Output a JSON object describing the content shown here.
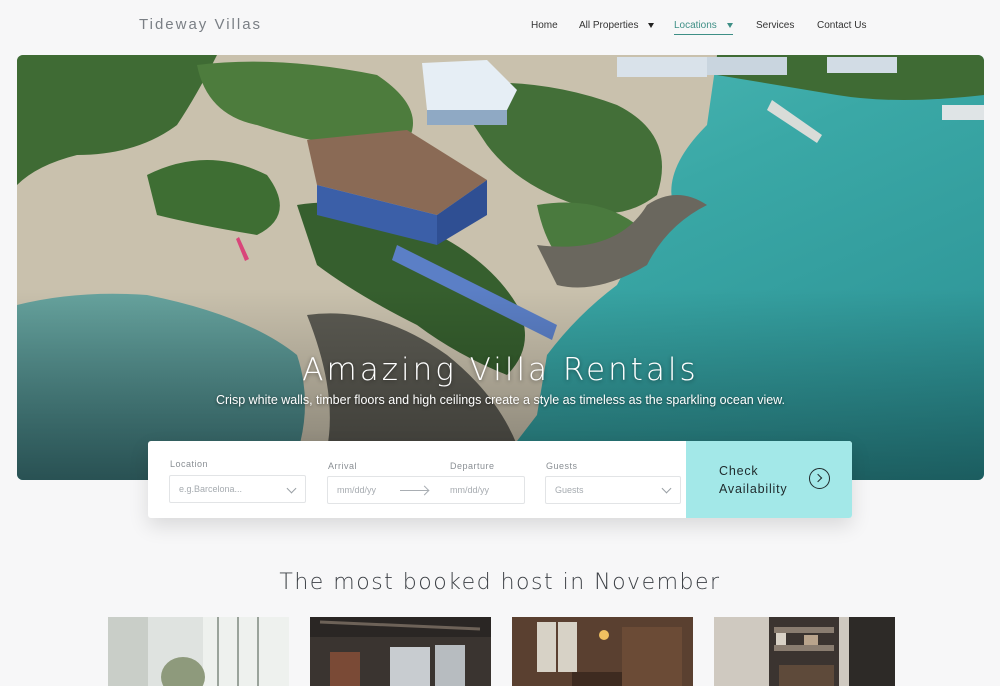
{
  "header": {
    "brand": "Tideway Villas",
    "nav": [
      {
        "label": "Home",
        "dropdown": false,
        "active": false
      },
      {
        "label": "All Properties",
        "dropdown": true,
        "active": false
      },
      {
        "label": "Locations",
        "dropdown": true,
        "active": true
      },
      {
        "label": "Services",
        "dropdown": false,
        "active": false
      },
      {
        "label": "Contact Us",
        "dropdown": false,
        "active": false
      }
    ]
  },
  "hero": {
    "title": "Amazing Villa Rentals",
    "subtitle": "Crisp white walls, timber floors and high ceilings create a style as timeless as the sparkling ocean view."
  },
  "booking": {
    "location": {
      "label": "Location",
      "placeholder": "e.g.Barcelona..."
    },
    "arrival": {
      "label": "Arrival",
      "placeholder": "mm/dd/yy"
    },
    "departure": {
      "label": "Departure",
      "placeholder": "mm/dd/yy"
    },
    "guests": {
      "label": "Guests",
      "placeholder": "Guests"
    },
    "cta": {
      "line1": "Check",
      "line2": "Availability",
      "icon": "arrow-right-circle-icon"
    }
  },
  "section": {
    "title": "The most booked host in November"
  },
  "colors": {
    "accent": "#3e8f86",
    "cta_bg": "#a3e8e8",
    "water": "#3fb3ae"
  }
}
